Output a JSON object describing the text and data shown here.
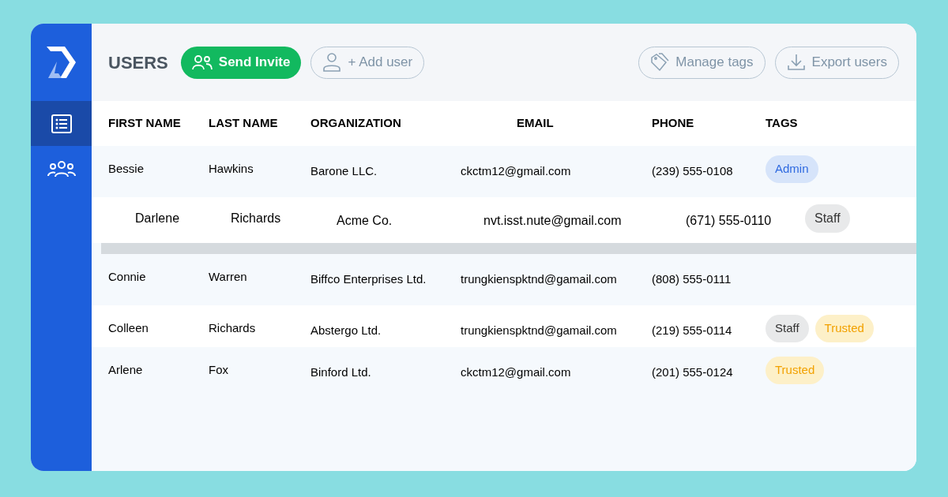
{
  "sidebar": {
    "items": [
      {
        "kind": "list",
        "selected": true
      },
      {
        "kind": "users",
        "selected": false
      }
    ]
  },
  "header": {
    "title": "USERS",
    "buttons": [
      {
        "kind": "invite",
        "label": "Send Invite"
      },
      {
        "kind": "add",
        "label": "+ Add user"
      },
      {
        "kind": "tags",
        "label": "Manage tags"
      },
      {
        "kind": "export",
        "label": "Export users"
      }
    ]
  },
  "table": {
    "columns": [
      "FIRST NAME",
      "LAST NAME",
      "ORGANIZATION",
      "EMAIL",
      "PHONE",
      "TAGS"
    ],
    "rows": [
      {
        "first_name": "Bessie",
        "last_name": "Hawkins",
        "organization": "Barone LLC.",
        "email": "ckctm12@gmail.com",
        "phone": "(239) 555-0108",
        "dragging": false,
        "tags": [
          {
            "kind": "admin",
            "label": "Admin"
          }
        ]
      },
      {
        "first_name": "Darlene",
        "last_name": "Richards",
        "organization": "Acme Co.",
        "email": "nvt.isst.nute@gmail.com",
        "phone": "(671) 555-0110",
        "dragging": true,
        "tags": [
          {
            "kind": "staff",
            "label": "Staff"
          }
        ]
      },
      {
        "first_name": "Connie",
        "last_name": "Warren",
        "organization": "Biffco Enterprises Ltd.",
        "email": "trungkienspktnd@gamail.com",
        "phone": "(808) 555-0111",
        "dragging": false,
        "tags": []
      },
      {
        "first_name": "Colleen",
        "last_name": "Richards",
        "organization": "Abstergo Ltd.",
        "email": "trungkienspktnd@gamail.com",
        "phone": "(219) 555-0114",
        "dragging": false,
        "tags": [
          {
            "kind": "staff",
            "label": "Staff"
          },
          {
            "kind": "trusted",
            "label": "Trusted"
          }
        ]
      },
      {
        "first_name": "Arlene",
        "last_name": "Fox",
        "organization": "Binford Ltd.",
        "email": "ckctm12@gmail.com",
        "phone": "(201) 555-0124",
        "dragging": false,
        "tags": [
          {
            "kind": "trusted",
            "label": "Trusted"
          }
        ]
      }
    ]
  }
}
